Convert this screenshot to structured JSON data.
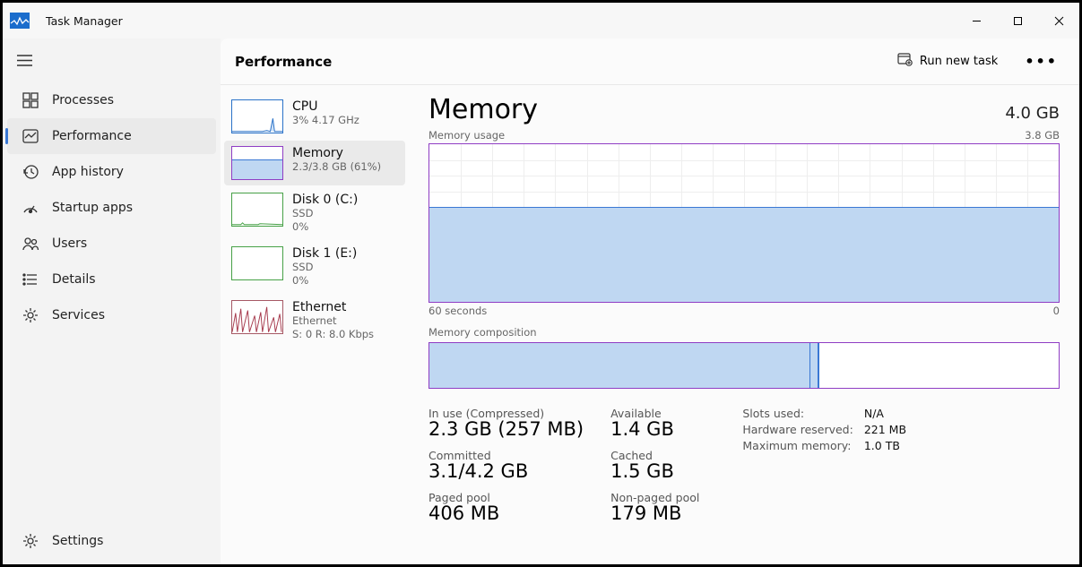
{
  "app_title": "Task Manager",
  "window_controls": {
    "minimize": "—",
    "maximize": "▢",
    "close": "✕"
  },
  "sidebar": {
    "items": [
      {
        "label": "Processes"
      },
      {
        "label": "Performance"
      },
      {
        "label": "App history"
      },
      {
        "label": "Startup apps"
      },
      {
        "label": "Users"
      },
      {
        "label": "Details"
      },
      {
        "label": "Services"
      }
    ],
    "settings_label": "Settings"
  },
  "header": {
    "title": "Performance",
    "run_new_task": "Run new task"
  },
  "mini": {
    "cpu": {
      "title": "CPU",
      "sub": "3%  4.17 GHz"
    },
    "memory": {
      "title": "Memory",
      "sub": "2.3/3.8 GB (61%)"
    },
    "disk0": {
      "title": "Disk 0 (C:)",
      "sub1": "SSD",
      "sub2": "0%"
    },
    "disk1": {
      "title": "Disk 1 (E:)",
      "sub1": "SSD",
      "sub2": "0%"
    },
    "eth": {
      "title": "Ethernet",
      "sub1": "Ethernet",
      "sub2": "S: 0 R: 8.0 Kbps"
    }
  },
  "detail": {
    "title": "Memory",
    "total": "4.0 GB",
    "usage_label": "Memory usage",
    "usage_max": "3.8 GB",
    "x_left": "60 seconds",
    "x_right": "0",
    "comp_label": "Memory composition",
    "stats": {
      "inuse_label": "In use (Compressed)",
      "inuse_value": "2.3 GB (257 MB)",
      "avail_label": "Available",
      "avail_value": "1.4 GB",
      "commit_label": "Committed",
      "commit_value": "3.1/4.2 GB",
      "cached_label": "Cached",
      "cached_value": "1.5 GB",
      "paged_label": "Paged pool",
      "paged_value": "406 MB",
      "nonpaged_label": "Non-paged pool",
      "nonpaged_value": "179 MB"
    },
    "right": {
      "slots_label": "Slots used:",
      "slots_value": "N/A",
      "hw_label": "Hardware reserved:",
      "hw_value": "221 MB",
      "max_label": "Maximum memory:",
      "max_value": "1.0 TB"
    }
  },
  "chart_data": {
    "type": "area",
    "title": "Memory usage",
    "ylabel": "",
    "xlabel": "",
    "ylim": [
      0,
      3.8
    ],
    "xlim_seconds": [
      60,
      0
    ],
    "series": [
      {
        "name": "Memory (GB)",
        "value_flat": 2.3
      }
    ],
    "composition": {
      "in_use_gb": 2.3,
      "modified_gb": 0.05,
      "standby_free_gb": 1.45,
      "total_gb": 3.8
    }
  }
}
